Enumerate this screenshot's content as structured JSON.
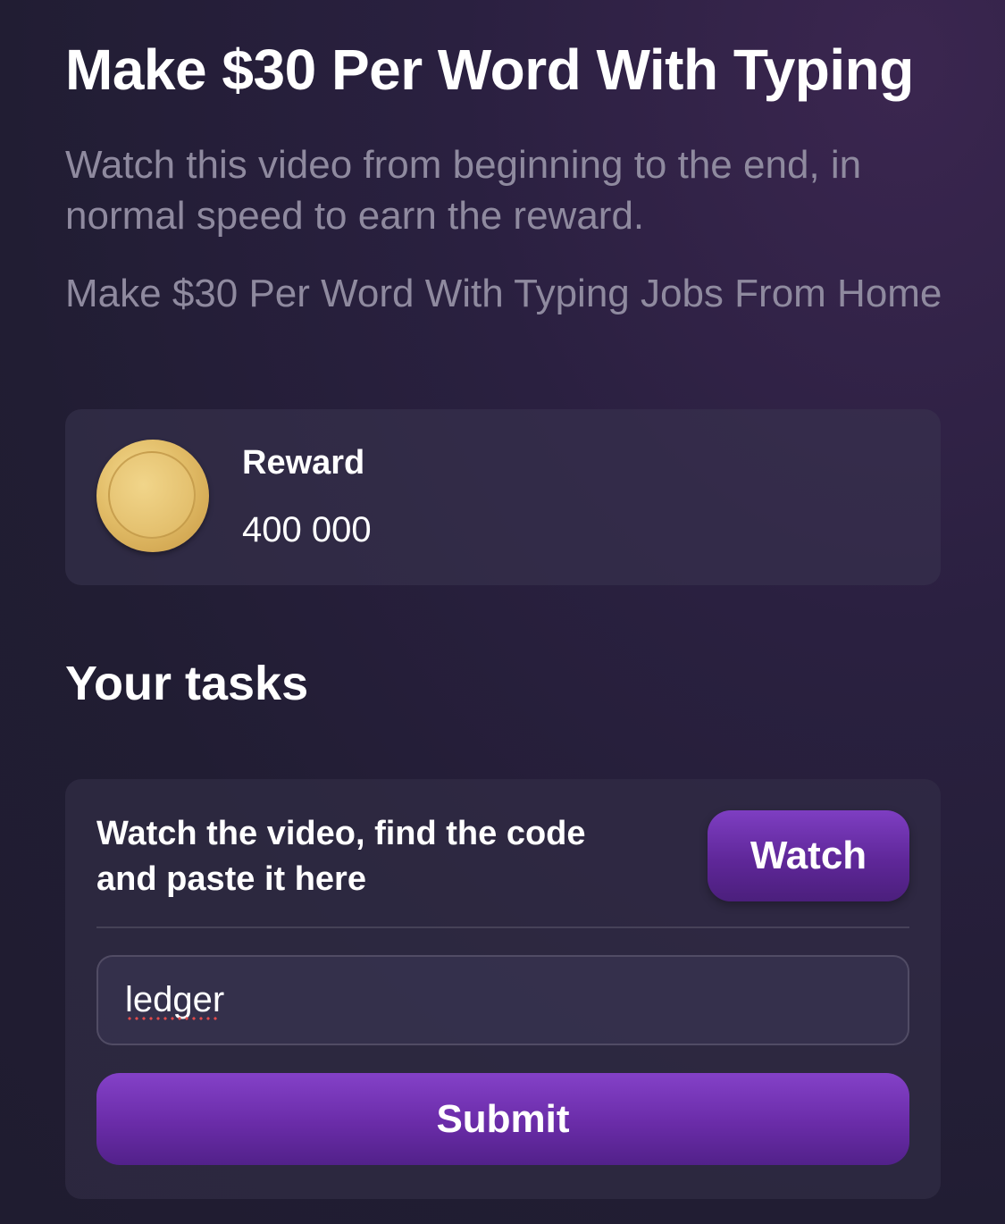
{
  "header": {
    "title": "Make $30 Per Word With Typing",
    "description": "Watch this video from beginning to the end, in normal speed to earn the reward.",
    "subtitle": "Make $30 Per Word With Typing Jobs From Home"
  },
  "reward": {
    "label": "Reward",
    "value": "400 000",
    "icon": "coin-icon"
  },
  "tasks": {
    "section_title": "Your tasks",
    "task_text": "Watch the video, find the code and paste it here",
    "watch_label": "Watch",
    "code_value": "ledger",
    "submit_label": "Submit"
  },
  "colors": {
    "accent": "#6a2ca8",
    "muted_text": "#8f8a9f",
    "background": "#211d33"
  }
}
